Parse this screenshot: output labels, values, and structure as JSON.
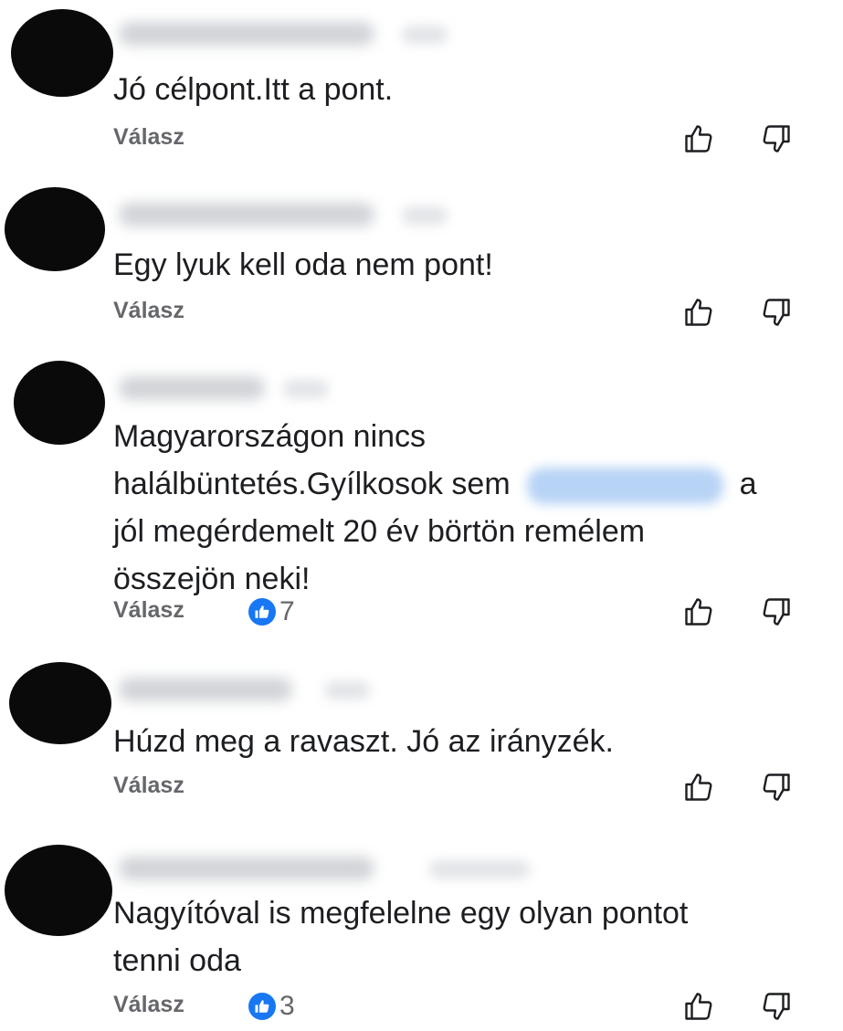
{
  "comments": [
    {
      "lines": [
        "Jó célpont.Itt a pont."
      ],
      "reply_label": "Válasz",
      "reactions": null
    },
    {
      "lines": [
        "Egy lyuk kell oda nem pont!"
      ],
      "reply_label": "Válasz",
      "reactions": null
    },
    {
      "lines": [
        "Magyarországon nincs",
        "halálbüntetés.Gyílkosok sem",
        "a",
        "jól megérdemelt 20 év börtön remélem",
        "összejön neki!"
      ],
      "reply_label": "Válasz",
      "reactions": "7"
    },
    {
      "lines": [
        "Húzd meg a ravaszt. Jó az irányzék."
      ],
      "reply_label": "Válasz",
      "reactions": null
    },
    {
      "lines": [
        "Nagyítóval is megfelelne egy olyan pontot",
        "tenni oda"
      ],
      "reply_label": "Válasz",
      "reactions": "3"
    }
  ],
  "icons": {
    "like": "thumbs-up-icon",
    "dislike": "thumbs-down-icon",
    "reaction": "like-reaction-icon"
  },
  "colors": {
    "accent": "#1877f2",
    "secondary_text": "#65676b",
    "primary_text": "#1c1e21",
    "avatar": "#0a0a0a"
  }
}
